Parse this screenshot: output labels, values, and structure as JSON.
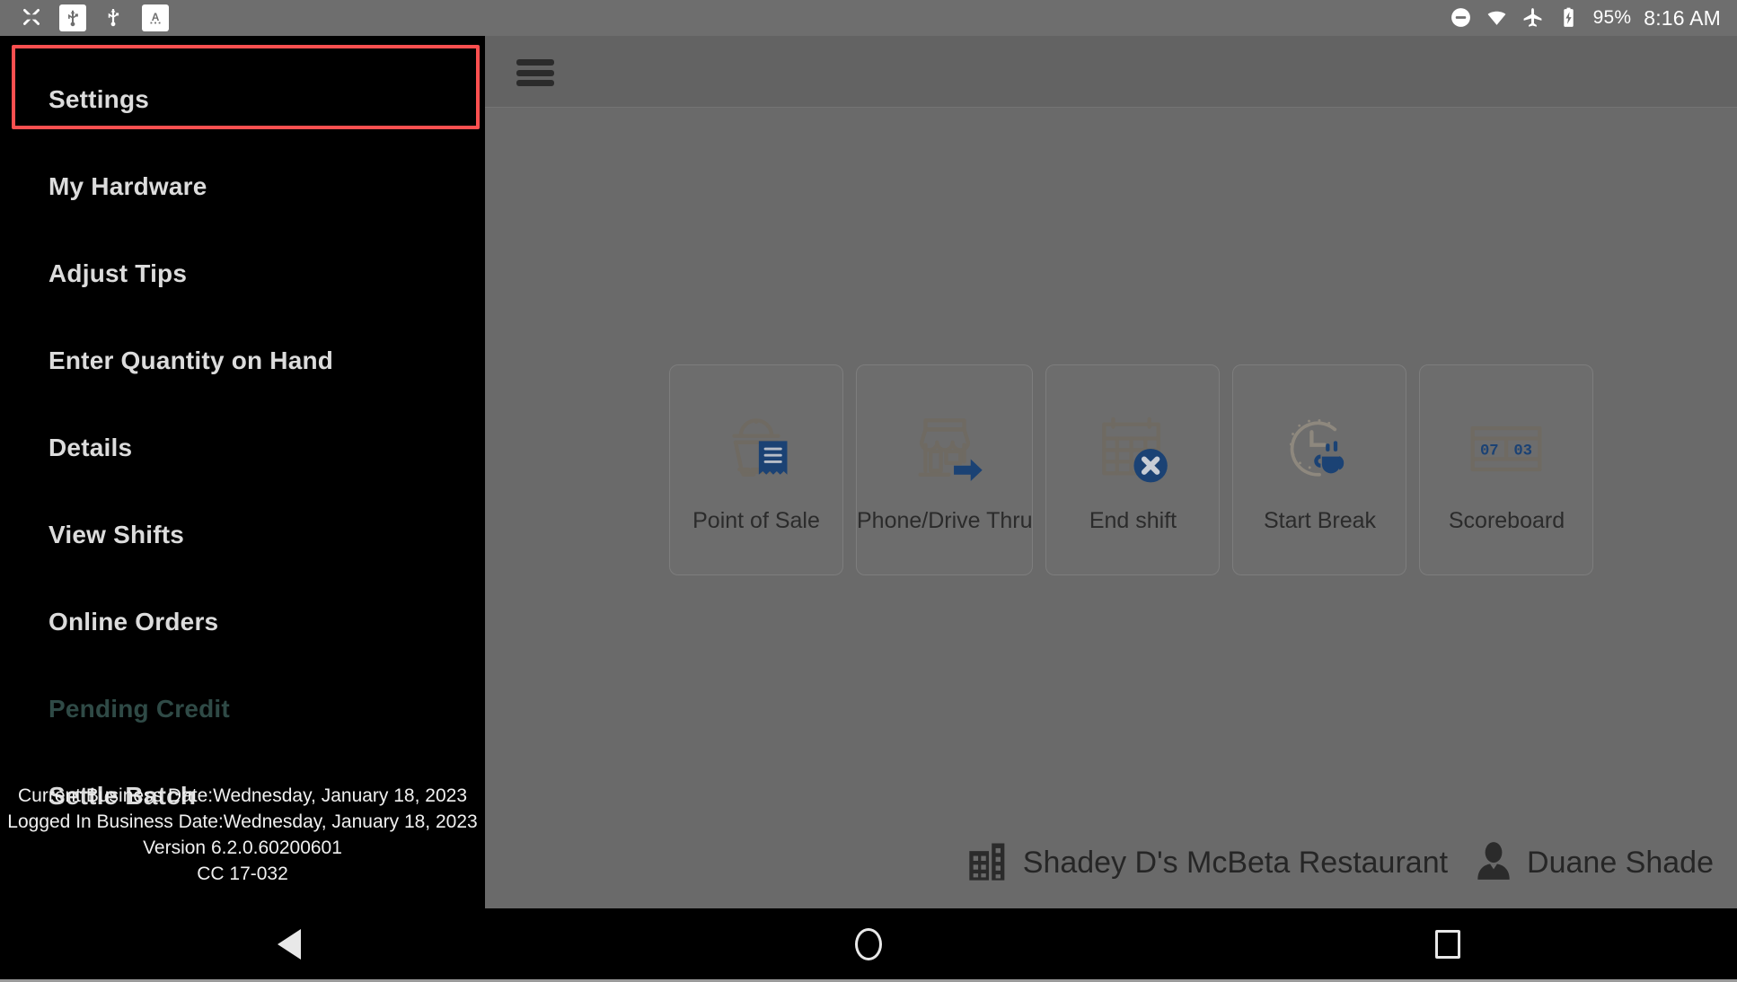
{
  "statusbar": {
    "left_icons": [
      "cut-icon",
      "usb-icon",
      "usb-alt-icon",
      "keyboard-a-icon"
    ],
    "right_icons": [
      "do-not-disturb-icon",
      "wifi-icon",
      "airplane-mode-icon",
      "battery-charging-icon"
    ],
    "battery_percent": "95%",
    "time": "8:16 AM"
  },
  "topbar": {
    "menu_icon": "hamburger-menu-icon"
  },
  "tiles": [
    {
      "label": "Point of Sale",
      "icon": "cloche-receipt-icon"
    },
    {
      "label": "Phone/Drive Thru",
      "icon": "storefront-arrow-icon"
    },
    {
      "label": "End shift",
      "icon": "calendar-x-icon"
    },
    {
      "label": "Start Break",
      "icon": "clock-coffee-icon"
    },
    {
      "label": "Scoreboard",
      "icon": "scoreboard-icon",
      "scoreboard_left": "07",
      "scoreboard_right": "03"
    }
  ],
  "bottom_info": {
    "store_icon": "building-icon",
    "store_name": "Shadey D's McBeta Restaurant",
    "user_icon": "user-avatar-icon",
    "user_name": "Duane Shade"
  },
  "drawer": {
    "items": [
      {
        "label": "Settings",
        "disabled": false,
        "highlighted": true
      },
      {
        "label": "My Hardware",
        "disabled": false,
        "highlighted": false
      },
      {
        "label": "Adjust Tips",
        "disabled": false,
        "highlighted": false
      },
      {
        "label": "Enter Quantity on Hand",
        "disabled": false,
        "highlighted": false
      },
      {
        "label": "Details",
        "disabled": false,
        "highlighted": false
      },
      {
        "label": "View Shifts",
        "disabled": false,
        "highlighted": false
      },
      {
        "label": "Online Orders",
        "disabled": false,
        "highlighted": false
      },
      {
        "label": "Pending Credit",
        "disabled": true,
        "highlighted": false
      },
      {
        "label": "Settle Batch",
        "disabled": false,
        "highlighted": false
      }
    ],
    "footer": {
      "current_business_date": "Current Business Date:Wednesday, January 18, 2023",
      "logged_in_business_date": "Logged In Business Date:Wednesday, January 18, 2023",
      "version": "Version 6.2.0.60200601",
      "cc": "CC 17-032"
    }
  },
  "navbar": {
    "back": "back-nav-icon",
    "home": "home-nav-icon",
    "recents": "recents-nav-icon"
  },
  "colors": {
    "highlight_border": "#fc4f4f",
    "drawer_bg": "#000000",
    "disabled_text": "#2f4a46",
    "icon_blue": "#1b4274",
    "icon_grey": "#6f6a62"
  }
}
